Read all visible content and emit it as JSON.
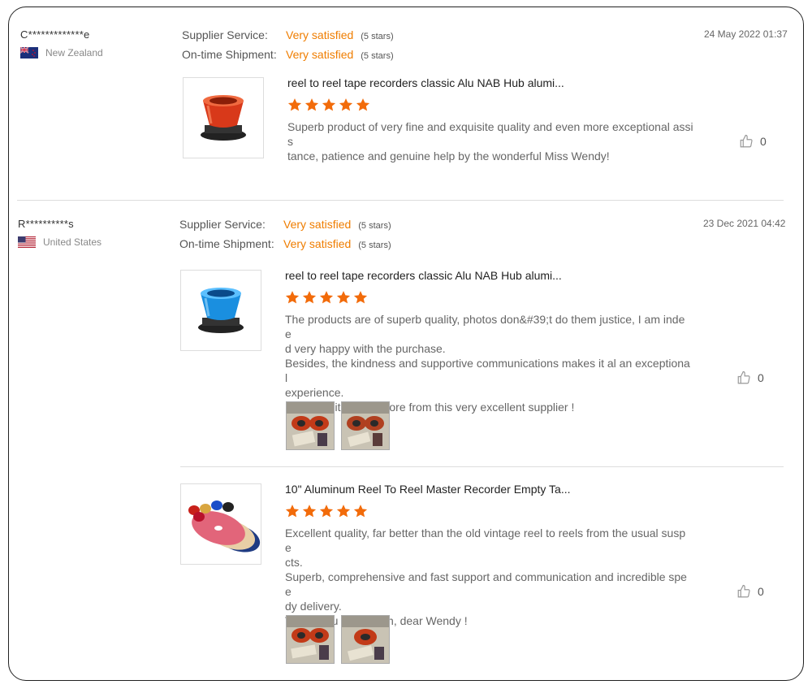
{
  "reviews": [
    {
      "buyer": "C*************e",
      "country": "New Zealand",
      "date": "24 May 2022 01:37",
      "supplier_label": "Supplier Service:",
      "supplier_value": "Very satisfied",
      "supplier_stars": "(5 stars)",
      "shipment_label": "On-time Shipment:",
      "shipment_value": "Very satisfied",
      "shipment_stars": "(5 stars)",
      "products": [
        {
          "title": "reel to reel tape recorders classic Alu NAB Hub alumi...",
          "rating": 5,
          "text": [
            "Superb product of very fine and exquisite quality and even more exceptional assis",
            "tance, patience and genuine help by the wonderful Miss Wendy!"
          ],
          "likes": "0",
          "thumb_color": "#e0401a"
        }
      ]
    },
    {
      "buyer": "R**********s",
      "country": "United States",
      "date": "23 Dec 2021 04:42",
      "supplier_label": "Supplier Service:",
      "supplier_value": "Very satisfied",
      "supplier_stars": "(5 stars)",
      "shipment_label": "On-time Shipment:",
      "shipment_value": "Very satisfied",
      "shipment_stars": "(5 stars)",
      "products": [
        {
          "title": "reel to reel tape recorders classic Alu NAB Hub alumi...",
          "rating": 5,
          "text": [
            "The products are of superb quality, photos don&#39;t do them justice, I am indee",
            "d very happy with the purchase.",
            "Besides, the kindness and supportive communications makes it al an exceptional",
            "experience.",
            "I will definitely buy more from this very excellent supplier !"
          ],
          "likes": "0",
          "thumb_color": "#1a8fe0"
        },
        {
          "title": "10\" Aluminum Reel To Reel Master Recorder Empty Ta...",
          "rating": 5,
          "text": [
            "Excellent quality, far better than the old vintage reel to reels from the usual suspe",
            "cts.",
            "Superb, comprehensive and fast support and communication and incredible spee",
            "dy delivery.",
            "Thank you very much, dear Wendy !"
          ],
          "likes": "0",
          "thumb_color": "#d84050"
        }
      ]
    }
  ],
  "colors": {
    "accent": "#ef7d00",
    "star": "#f26b0a",
    "divider": "#dddddd"
  },
  "icons": {
    "like": "thumbs-up-icon",
    "star": "star-icon"
  }
}
